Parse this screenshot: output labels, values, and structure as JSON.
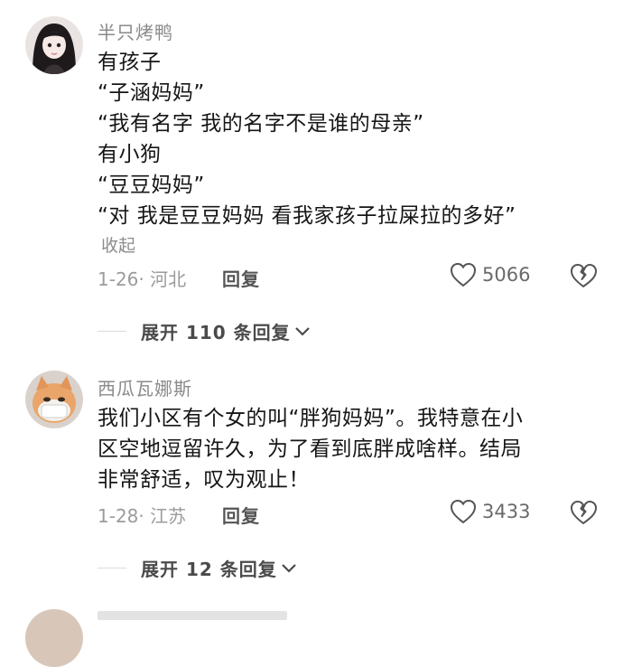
{
  "comments": [
    {
      "username": "半只烤鸭",
      "lines": [
        "有孩子",
        "“子涵妈妈”",
        "“我有名字 我的名字不是谁的母亲”",
        "有小狗",
        "“豆豆妈妈”",
        "“对 我是豆豆妈妈 看我家孩子拉屎拉的多好”"
      ],
      "collapse_label": "收起",
      "meta": "1-26· 河北",
      "reply_label": "回复",
      "like_count": "5066",
      "expand_label": "展开 110 条回复"
    },
    {
      "username": "西瓜瓦娜斯",
      "lines": [
        "我们小区有个女的叫“胖狗妈妈”。我特意在小",
        "区空地逗留许久，为了看到底胖成啥样。结局",
        "非常舒适，叹为观止！"
      ],
      "meta": "1-28· 江苏",
      "reply_label": "回复",
      "like_count": "3433",
      "expand_label": "展开 12 条回复"
    }
  ],
  "icons": {
    "like": "heart-outline-icon",
    "dislike": "broken-heart-icon",
    "expand": "chevron-down-icon"
  }
}
